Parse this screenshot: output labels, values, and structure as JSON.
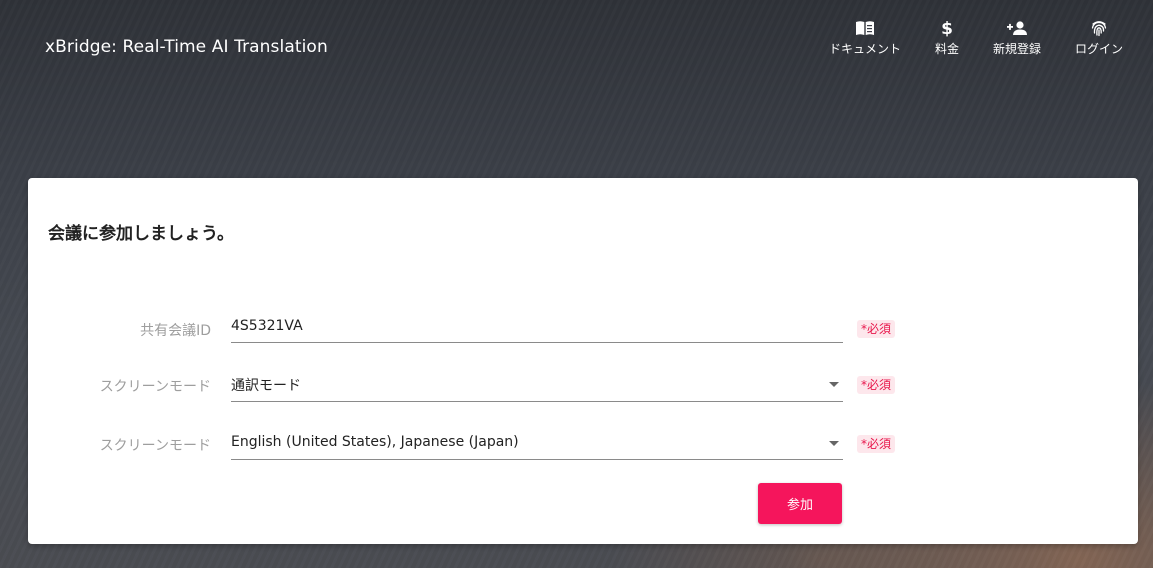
{
  "app": {
    "title": "xBridge: Real-Time AI Translation"
  },
  "nav": {
    "items": [
      {
        "label": "ドキュメント",
        "icon": "book-icon"
      },
      {
        "label": "料金",
        "icon": "dollar-icon"
      },
      {
        "label": "新規登録",
        "icon": "person-add-icon"
      },
      {
        "label": "ログイン",
        "icon": "fingerprint-icon"
      }
    ]
  },
  "card": {
    "title": "会議に参加しましょう。",
    "fields": [
      {
        "label": "共有会議ID",
        "value": "4S5321VA",
        "required": "*必須",
        "type": "text"
      },
      {
        "label": "スクリーンモード",
        "value": "通訳モード",
        "required": "*必須",
        "type": "select"
      },
      {
        "label": "スクリーンモード",
        "value": "English (United States), Japanese (Japan)",
        "required": "*必須",
        "type": "select"
      }
    ],
    "submit_label": "参加"
  },
  "colors": {
    "accent": "#f5155c",
    "required_text": "#e8164b",
    "required_bg": "#fde7ec"
  }
}
